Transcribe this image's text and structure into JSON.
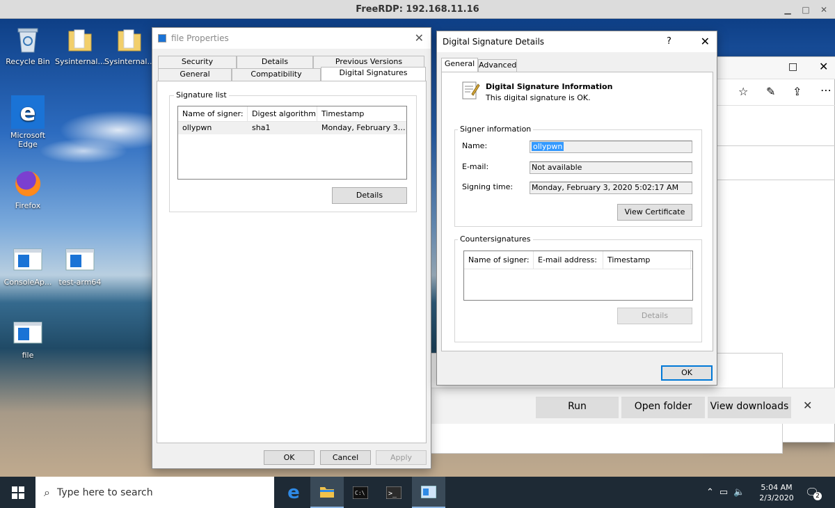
{
  "rdp": {
    "title": "FreeRDP: 192.168.11.16"
  },
  "desktop": {
    "icons": [
      {
        "label": "Recycle Bin",
        "icon": "recycle-bin-icon"
      },
      {
        "label": "Sysinternal...",
        "icon": "folder-icon"
      },
      {
        "label": "Sysinternal...",
        "icon": "folder-icon"
      },
      {
        "label": "Microsoft Edge",
        "icon": "edge-icon"
      },
      {
        "label": "Firefox",
        "icon": "firefox-icon"
      },
      {
        "label": "ConsoleAp...",
        "icon": "app-window-icon"
      },
      {
        "label": "test-arm64",
        "icon": "app-window-icon"
      },
      {
        "label": "file",
        "icon": "app-window-icon"
      }
    ]
  },
  "props": {
    "title": "file Properties",
    "tabs_row1": [
      "Security",
      "Details",
      "Previous Versions"
    ],
    "tabs_row2": [
      "General",
      "Compatibility",
      "Digital Signatures"
    ],
    "group_label": "Signature list",
    "columns": [
      "Name of signer:",
      "Digest algorithm",
      "Timestamp"
    ],
    "rows": [
      [
        "ollypwn",
        "sha1",
        "Monday, February 3, ..."
      ]
    ],
    "details_btn": "Details",
    "ok": "OK",
    "cancel": "Cancel",
    "apply": "Apply"
  },
  "sig": {
    "title": "Digital Signature Details",
    "help": "?",
    "tabs": [
      "General",
      "Advanced"
    ],
    "info_title": "Digital Signature Information",
    "info_text": "This digital signature is OK.",
    "signer_group": "Signer information",
    "name_label": "Name:",
    "name_value": "ollypwn",
    "email_label": "E-mail:",
    "email_value": "Not available",
    "time_label": "Signing time:",
    "time_value": "Monday, February 3, 2020 5:02:17 AM",
    "view_cert": "View Certificate",
    "counter_group": "Countersignatures",
    "counter_columns": [
      "Name of signer:",
      "E-mail address:",
      "Timestamp"
    ],
    "counter_details": "Details",
    "ok": "OK"
  },
  "download_bar": {
    "run": "Run",
    "open_folder": "Open folder",
    "view_downloads": "View downloads"
  },
  "taskbar": {
    "search_placeholder": "Type here to search",
    "time": "5:04 AM",
    "date": "2/3/2020",
    "notifications": "2"
  }
}
